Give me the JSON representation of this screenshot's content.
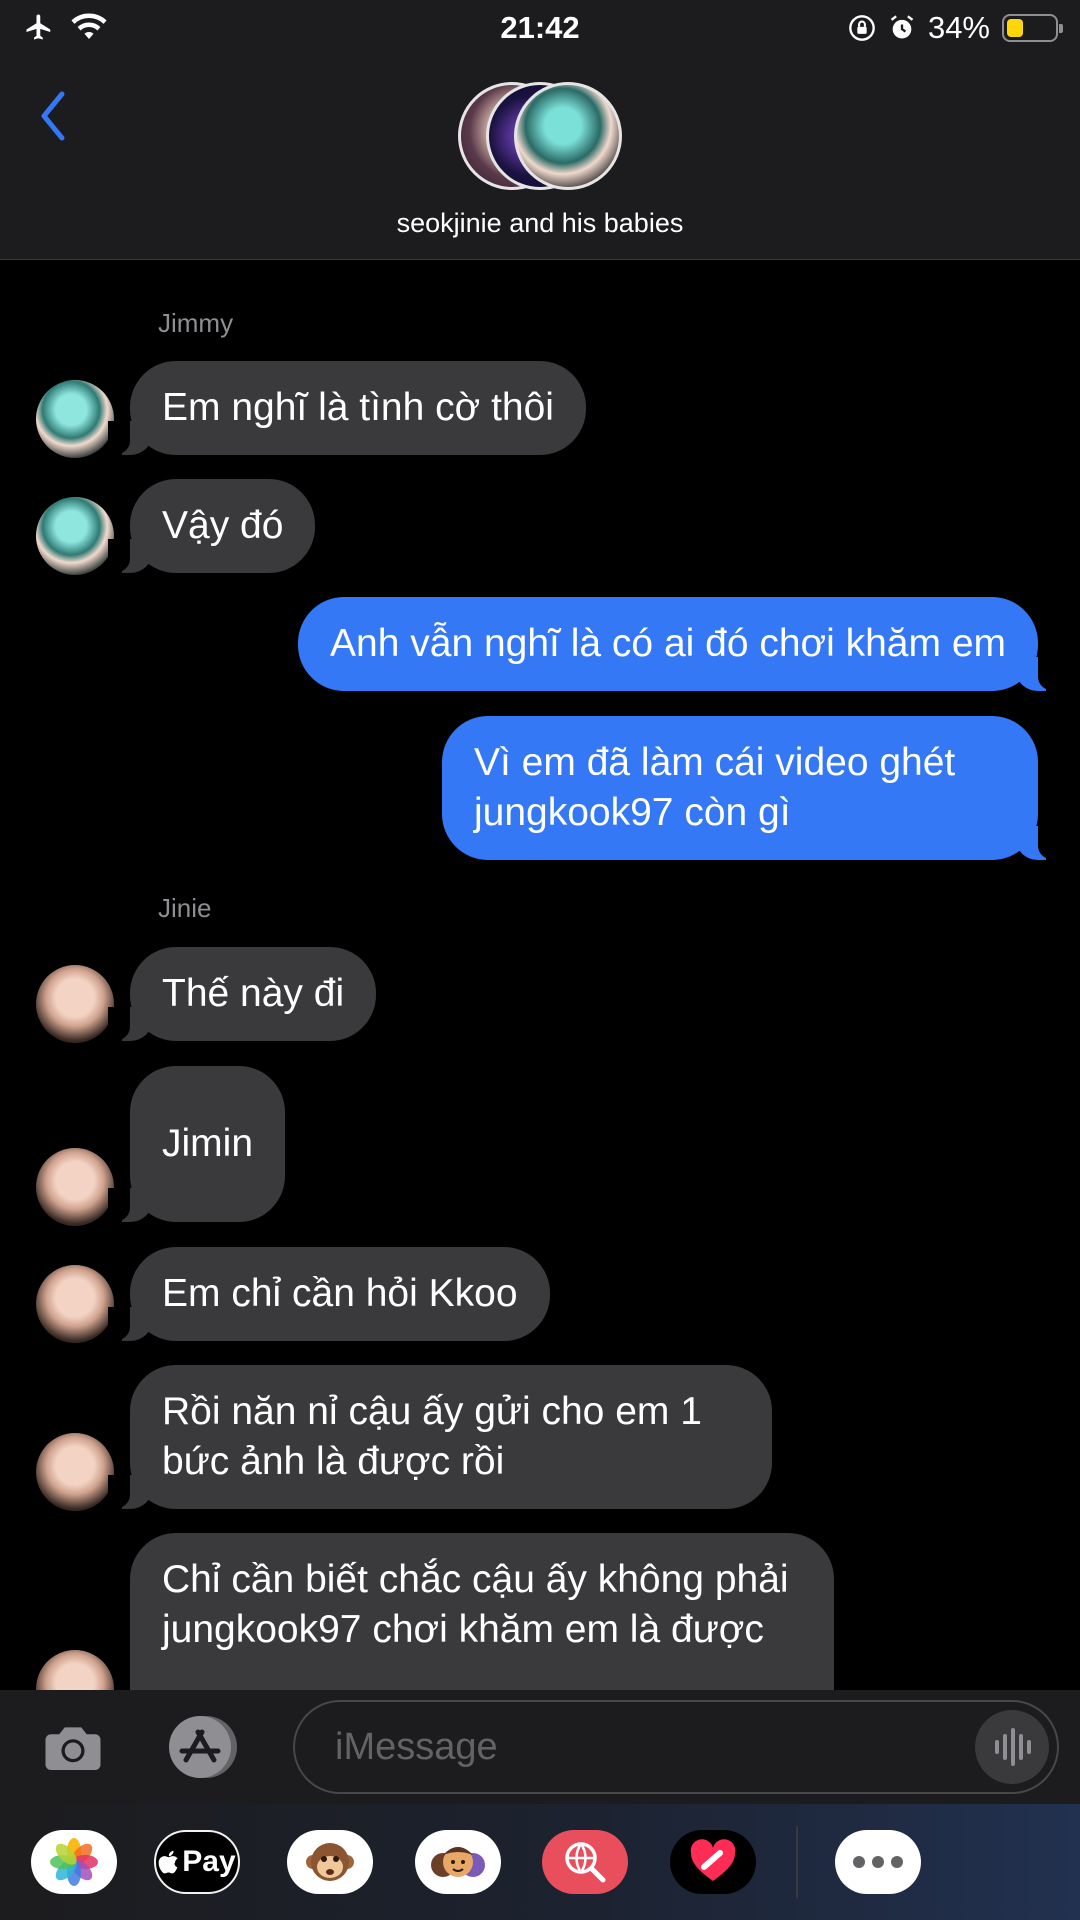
{
  "status_bar": {
    "time": "21:42",
    "battery_percent": "34%",
    "battery_level": 0.34,
    "icons": [
      "airplane-icon",
      "wifi-icon",
      "orientation-lock-icon",
      "alarm-icon",
      "battery-icon"
    ]
  },
  "header": {
    "group_name": "seokjinie and his babies"
  },
  "messages": [
    {
      "sender_label": "Jimmy"
    },
    {
      "text": "Em nghĩ là tình cờ thôi"
    },
    {
      "text": "Vậy đó"
    },
    {
      "text": "Anh vẫn nghĩ là có ai đó chơi khăm em"
    },
    {
      "text": "Vì em đã làm cái video ghét jungkook97 còn gì"
    },
    {
      "sender_label": "Jinie"
    },
    {
      "text": "Thế này đi"
    },
    {
      "text": "Jimin"
    },
    {
      "text": "Em chỉ cần hỏi Kkoo"
    },
    {
      "text": "Rồi năn nỉ cậu ấy gửi cho em 1 bức ảnh là được rồi"
    },
    {
      "text": "Chỉ cần biết chắc cậu ấy không phải jungkook97 chơi khăm em là được"
    }
  ],
  "input": {
    "placeholder": "iMessage",
    "value": ""
  },
  "drawer": {
    "apple_pay_label": "Pay"
  },
  "colors": {
    "outgoing_bubble": "#3478f6",
    "incoming_bubble": "#3a3a3c",
    "accent": "#3478f6",
    "battery_fill": "#ffd60a"
  }
}
